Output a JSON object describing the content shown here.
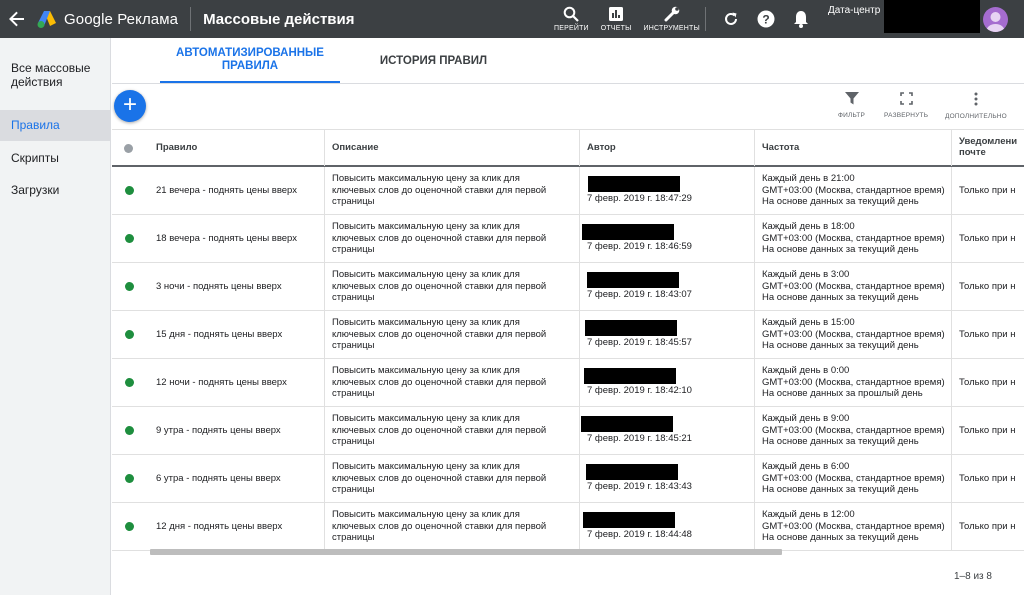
{
  "topbar": {
    "brand": "Google Реклама",
    "title": "Массовые действия",
    "tools": [
      {
        "icon": "search-icon",
        "label": "ПЕРЕЙТИ"
      },
      {
        "icon": "reports-icon",
        "label": "ОТЧЕТЫ"
      },
      {
        "icon": "wrench-icon",
        "label": "ИНСТРУМЕНТЫ"
      }
    ],
    "account_label": "Дата-центр I"
  },
  "sidebar": {
    "items": [
      {
        "label": "Все массовые действия"
      },
      {
        "label": "Правила"
      },
      {
        "label": "Скрипты"
      },
      {
        "label": "Загрузки"
      }
    ]
  },
  "tabs": [
    {
      "label": "АВТОМАТИЗИРОВАННЫЕ ПРАВИЛА"
    },
    {
      "label": "ИСТОРИЯ ПРАВИЛ"
    }
  ],
  "toolbar": {
    "add_label": "+",
    "filter_label": "ФИЛЬТР",
    "expand_label": "РАЗВЕРНУТЬ",
    "more_label": "ДОПОЛНИТЕЛЬНО"
  },
  "table": {
    "headers": {
      "rule": "Правило",
      "description": "Описание",
      "author": "Автор",
      "frequency": "Частота",
      "notify": "Уведомлени почте"
    },
    "rows": [
      {
        "name": "21 вечера - поднять цены вверх",
        "desc1": "Повысить максимальную цену за клик для",
        "desc2": "ключевых слов до оценочной ставки для первой",
        "desc3": "страницы",
        "date": "7 февр. 2019 г. 18:47:29",
        "freq1": "Каждый день в 21:00",
        "freq2": "GMT+03:00 (Москва, стандартное время)",
        "freq3": "На основе данных за текущий день",
        "notify": "Только при н"
      },
      {
        "name": "18 вечера - поднять цены вверх",
        "desc1": "Повысить максимальную цену за клик для",
        "desc2": "ключевых слов до оценочной ставки для первой",
        "desc3": "страницы",
        "date": "7 февр. 2019 г. 18:46:59",
        "freq1": "Каждый день в 18:00",
        "freq2": "GMT+03:00 (Москва, стандартное время)",
        "freq3": "На основе данных за текущий день",
        "notify": "Только при н"
      },
      {
        "name": "3 ночи - поднять цены вверх",
        "desc1": "Повысить максимальную цену за клик для",
        "desc2": "ключевых слов до оценочной ставки для первой",
        "desc3": "страницы",
        "date": "7 февр. 2019 г. 18:43:07",
        "freq1": "Каждый день в 3:00",
        "freq2": "GMT+03:00 (Москва, стандартное время)",
        "freq3": "На основе данных за текущий день",
        "notify": "Только при н"
      },
      {
        "name": "15 дня - поднять цены вверх",
        "desc1": "Повысить максимальную цену за клик для",
        "desc2": "ключевых слов до оценочной ставки для первой",
        "desc3": "страницы",
        "date": "7 февр. 2019 г. 18:45:57",
        "freq1": "Каждый день в 15:00",
        "freq2": "GMT+03:00 (Москва, стандартное время)",
        "freq3": "На основе данных за текущий день",
        "notify": "Только при н"
      },
      {
        "name": "12 ночи - поднять цены вверх",
        "desc1": "Повысить максимальную цену за клик для",
        "desc2": "ключевых слов до оценочной ставки для первой",
        "desc3": "страницы",
        "date": "7 февр. 2019 г. 18:42:10",
        "freq1": "Каждый день в 0:00",
        "freq2": "GMT+03:00 (Москва, стандартное время)",
        "freq3": "На основе данных за прошлый день",
        "notify": "Только при н"
      },
      {
        "name": "9 утра - поднять цены вверх",
        "desc1": "Повысить максимальную цену за клик для",
        "desc2": "ключевых слов до оценочной ставки для первой",
        "desc3": "страницы",
        "date": "7 февр. 2019 г. 18:45:21",
        "freq1": "Каждый день в 9:00",
        "freq2": "GMT+03:00 (Москва, стандартное время)",
        "freq3": "На основе данных за текущий день",
        "notify": "Только при н"
      },
      {
        "name": "6 утра - поднять цены вверх",
        "desc1": "Повысить максимальную цену за клик для",
        "desc2": "ключевых слов до оценочной ставки для первой",
        "desc3": "страницы",
        "date": "7 февр. 2019 г. 18:43:43",
        "freq1": "Каждый день в 6:00",
        "freq2": "GMT+03:00 (Москва, стандартное время)",
        "freq3": "На основе данных за текущий день",
        "notify": "Только при н"
      },
      {
        "name": "12 дня - поднять цены вверх",
        "desc1": "Повысить максимальную цену за клик для",
        "desc2": "ключевых слов до оценочной ставки для первой",
        "desc3": "страницы",
        "date": "7 февр. 2019 г. 18:44:48",
        "freq1": "Каждый день в 12:00",
        "freq2": "GMT+03:00 (Москва, стандартное время)",
        "freq3": "На основе данных за текущий день",
        "notify": "Только при н"
      }
    ]
  },
  "pagination": "1–8 из 8",
  "colors": {
    "accent": "#1a73e8",
    "status_enabled": "#1e8e3e",
    "topbar": "#3c4043"
  }
}
